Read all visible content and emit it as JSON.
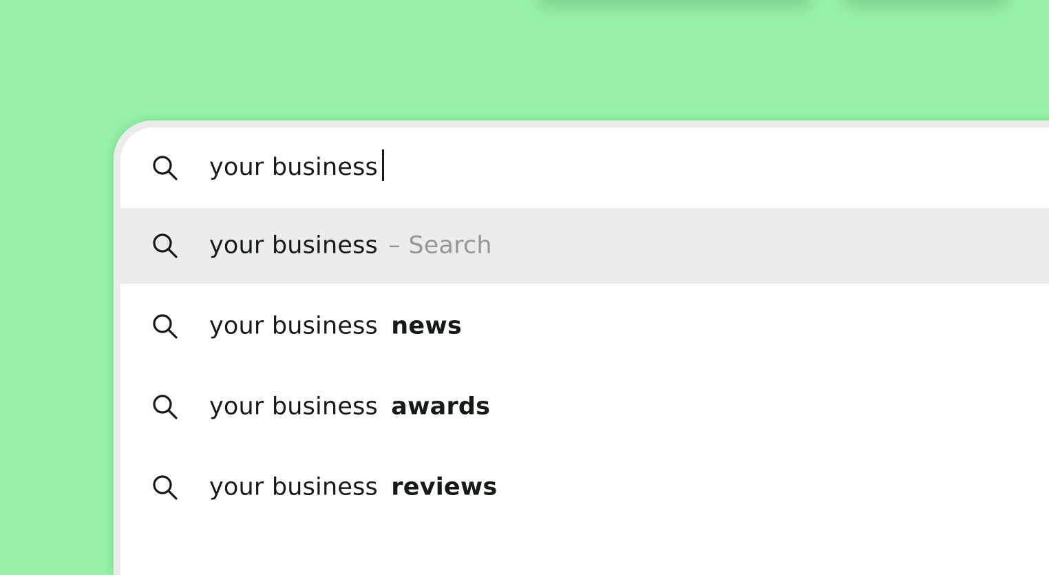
{
  "search": {
    "query": "your business",
    "suggestions": [
      {
        "base": "your business",
        "suffix": "– Search"
      },
      {
        "base": "your business",
        "bold": "news"
      },
      {
        "base": "your business",
        "bold": "awards"
      },
      {
        "base": "your business",
        "bold": "reviews"
      }
    ]
  },
  "icons": {
    "search": "search-icon"
  },
  "colors": {
    "background": "#97f2a7",
    "panel": "#ffffff",
    "selected_row": "#ececec",
    "text": "#141a14",
    "hint_text": "#949894"
  }
}
